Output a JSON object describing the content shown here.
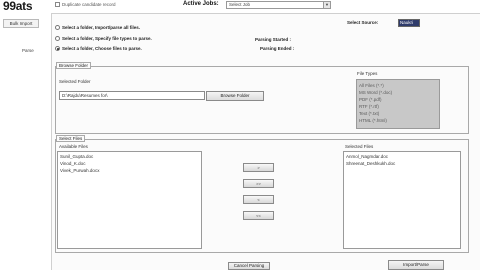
{
  "header": {
    "logo": "99ats",
    "checkbox_label": "Duplicate candidate record",
    "active_jobs_label": "Active Jobs:",
    "active_jobs_value": "Select Job"
  },
  "nav": {
    "bulk_import": "Bulk Import",
    "parse": "Parse"
  },
  "options": {
    "opt1": "Select a folder,  Import/parse all files.",
    "opt2": "Select a folder, Specify file types to parse.",
    "opt3": "Select a folder, Choose files to parse.",
    "selected_index": 3
  },
  "select_source": {
    "label": "Select Source:",
    "value": "Naukri"
  },
  "parsing": {
    "started": "Parsing Started :",
    "ended": "Parsing Ended :"
  },
  "browse_folder": {
    "legend": "Browse Folder",
    "selected_folder_label": "Selected Folder",
    "path": "D:\\Rajdu\\Resumes for\\",
    "browse_button": "Browse Folder"
  },
  "file_types": {
    "label": "File Types",
    "items": [
      "All Files (*.*)",
      "MS Word (*.doc)",
      "PDF (*.pdf)",
      "RTF (*.rtf)",
      "Text (*.txt)",
      "HTML (*.html)"
    ]
  },
  "select_files": {
    "legend": "Select Files",
    "available_label": "Available Files",
    "available": [
      "Sunil_Gupta.doc",
      "Vinod_K.doc",
      "Vivek_Purwah.docx"
    ],
    "selected_label": "Selected Files",
    "selected": [
      "Anmol_Nagmdar.doc",
      "Shreenat_Deshkukh.doc"
    ],
    "move_buttons": [
      ">",
      ">>",
      "<",
      "<<"
    ]
  },
  "footer": {
    "cancel_button": "Cancel Parsing",
    "import_button": "Import/Parse"
  }
}
